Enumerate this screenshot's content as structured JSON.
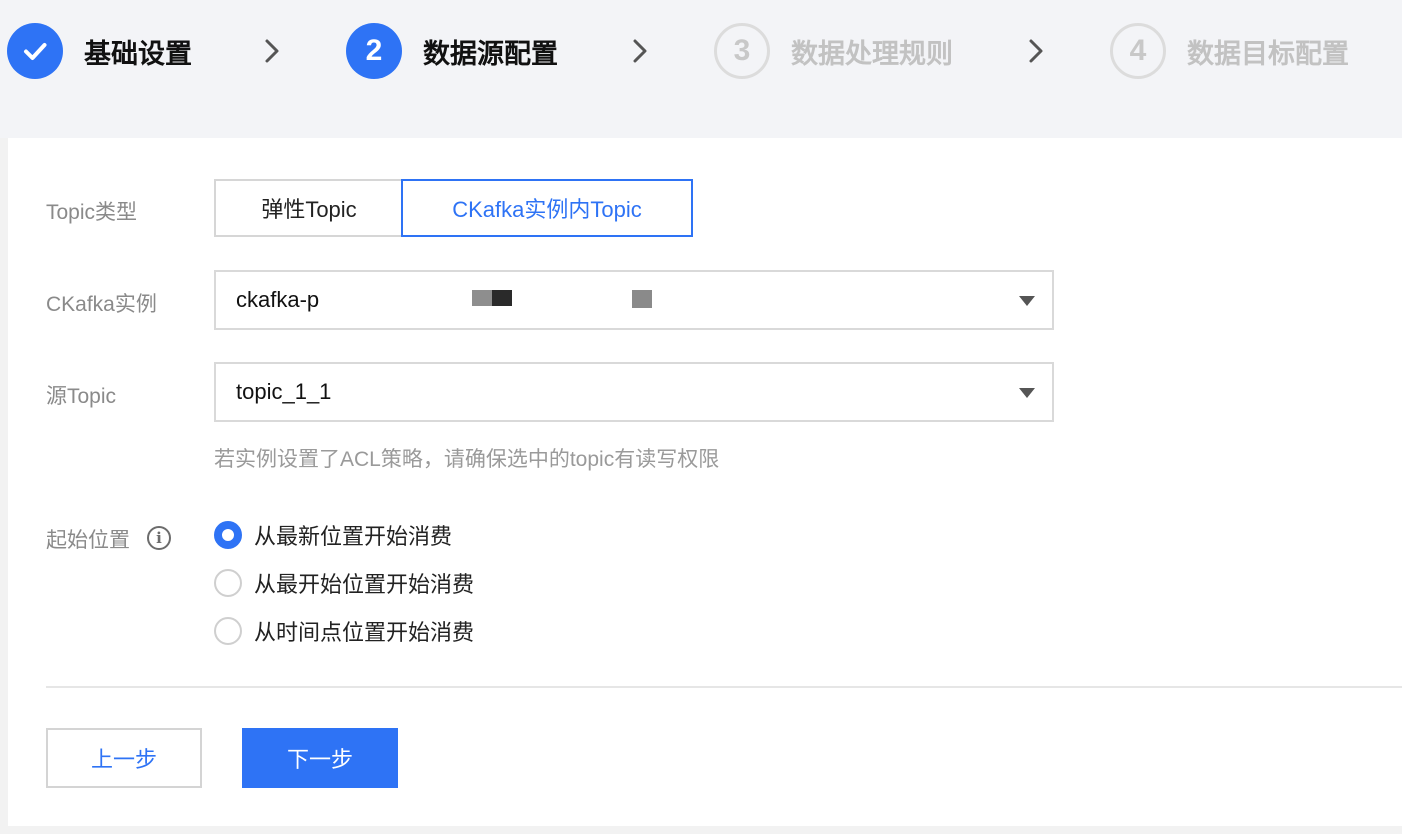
{
  "steps": [
    {
      "number": "",
      "label": "基础设置",
      "state": "done"
    },
    {
      "number": "2",
      "label": "数据源配置",
      "state": "active"
    },
    {
      "number": "3",
      "label": "数据处理规则",
      "state": "pending"
    },
    {
      "number": "4",
      "label": "数据目标配置",
      "state": "pending"
    }
  ],
  "form": {
    "topic_type": {
      "label": "Topic类型",
      "options": [
        "弹性Topic",
        "CKafka实例内Topic"
      ],
      "selected": "CKafka实例内Topic"
    },
    "instance": {
      "label": "CKafka实例",
      "value": "ckafka-p"
    },
    "source_topic": {
      "label": "源Topic",
      "value": "topic_1_1",
      "hint": "若实例设置了ACL策略，请确保选中的topic有读写权限"
    },
    "start_position": {
      "label": "起始位置",
      "options": [
        "从最新位置开始消费",
        "从最开始位置开始消费",
        "从时间点位置开始消费"
      ],
      "selected": "从最新位置开始消费"
    }
  },
  "buttons": {
    "prev": "上一步",
    "next": "下一步"
  },
  "colors": {
    "accent": "#2e73f5",
    "pending": "#c2c2c2"
  },
  "icons": {
    "done_step": "check-icon",
    "separator": "chevron-right-icon",
    "select": "caret-down-icon",
    "tooltip": "info-icon"
  }
}
